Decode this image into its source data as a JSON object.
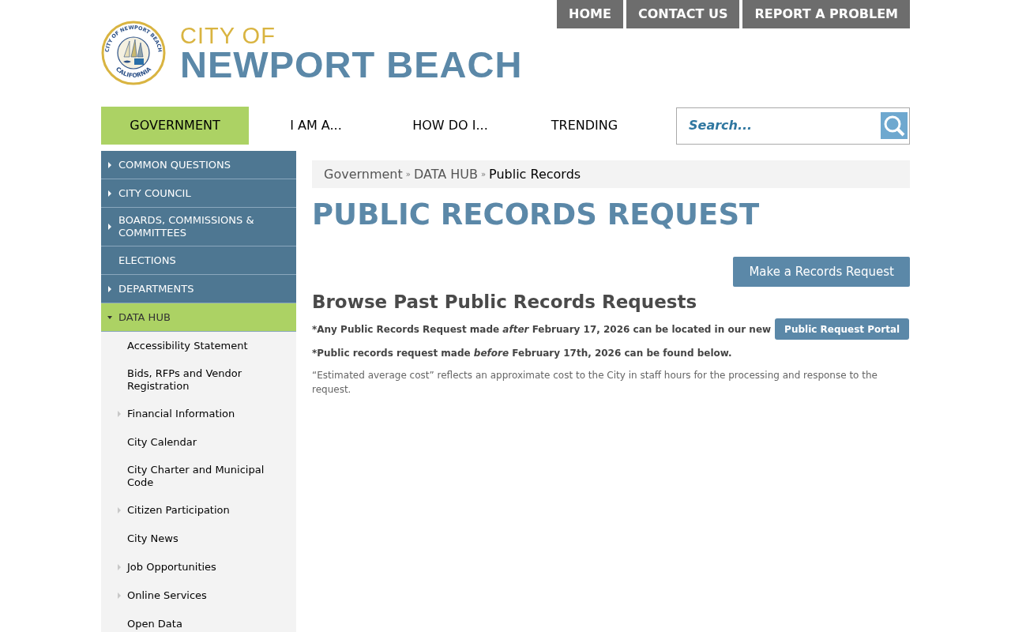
{
  "top_links": [
    "HOME",
    "CONTACT US",
    "REPORT A PROBLEM"
  ],
  "logo": {
    "seal_top": "CITY OF NEWPORT BEACH",
    "seal_bottom": "CALIFORNIA",
    "line1": "CITY OF",
    "line2": "NEWPORT BEACH"
  },
  "nav": [
    {
      "label": "GOVERNMENT",
      "selected": true
    },
    {
      "label": "I AM A...",
      "selected": false
    },
    {
      "label": "HOW DO I...",
      "selected": false
    },
    {
      "label": "TRENDING",
      "selected": false
    }
  ],
  "search": {
    "placeholder": "Search..."
  },
  "sidebar": [
    {
      "label": "COMMON QUESTIONS",
      "expandable": true,
      "selected": false
    },
    {
      "label": "CITY COUNCIL",
      "expandable": true,
      "selected": false
    },
    {
      "label": "BOARDS, COMMISSIONS & COMMITTEES",
      "expandable": true,
      "selected": false
    },
    {
      "label": "ELECTIONS",
      "expandable": false,
      "selected": false
    },
    {
      "label": "DEPARTMENTS",
      "expandable": true,
      "selected": false
    },
    {
      "label": "DATA HUB",
      "expandable": true,
      "selected": true,
      "children": [
        {
          "label": "Accessibility Statement",
          "expandable": false
        },
        {
          "label": "Bids, RFPs and Vendor Registration",
          "expandable": false
        },
        {
          "label": "Financial Information",
          "expandable": true
        },
        {
          "label": "City Calendar",
          "expandable": false
        },
        {
          "label": "City Charter and Municipal Code",
          "expandable": false
        },
        {
          "label": "Citizen Participation",
          "expandable": true
        },
        {
          "label": "City News",
          "expandable": false
        },
        {
          "label": "Job Opportunities",
          "expandable": true
        },
        {
          "label": "Online Services",
          "expandable": true
        },
        {
          "label": "Open Data",
          "expandable": false
        }
      ]
    }
  ],
  "breadcrumb": {
    "items": [
      "Government",
      "DATA HUB",
      "Public Records"
    ],
    "separator": "»"
  },
  "title": "PUBLIC RECORDS REQUEST",
  "request_button": "Make a Records Request",
  "subtitle": "Browse Past Public Records Requests",
  "note_after": "*Any Public Records Request made *after* February 17, 2026 can be located in our new",
  "portal_button": "Public Request Portal",
  "note_before": "*Public records request made *before* February 17th, 2026 can be found below.",
  "cost_note": "“Estimated average cost” reflects an approximate cost to the City in staff hours for the processing and response to the request."
}
